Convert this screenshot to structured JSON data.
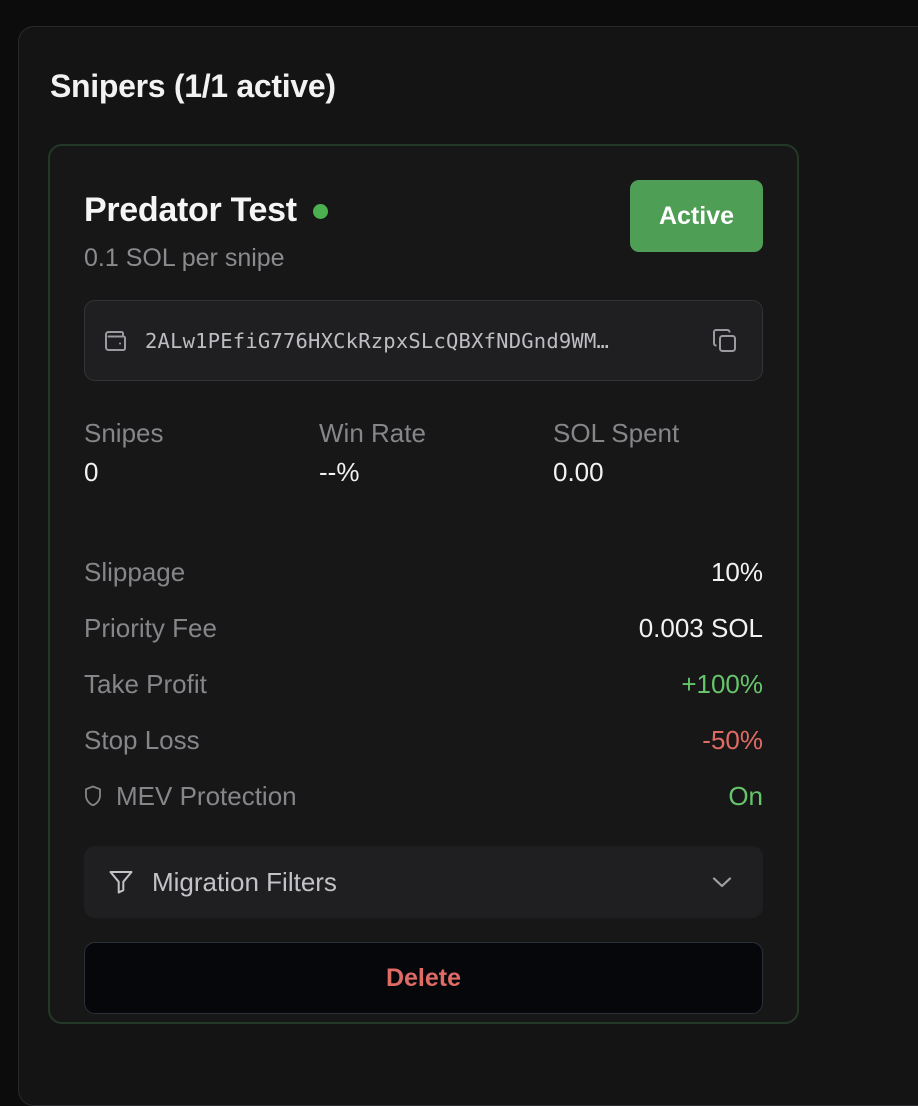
{
  "panel": {
    "title": "Snipers (1/1 active)"
  },
  "sniper": {
    "name": "Predator Test",
    "subtitle": "0.1 SOL per snipe",
    "status_button": "Active",
    "wallet_address": "2ALw1PEfiG776HXCkRzpxSLcQBXfNDGnd9WM…",
    "stats": [
      {
        "label": "Snipes",
        "value": "0"
      },
      {
        "label": "Win Rate",
        "value": "--%"
      },
      {
        "label": "SOL Spent",
        "value": "0.00"
      }
    ],
    "settings": [
      {
        "label": "Slippage",
        "value": "10%",
        "color": "#f2f2f3"
      },
      {
        "label": "Priority Fee",
        "value": "0.003 SOL",
        "color": "#f2f2f3"
      },
      {
        "label": "Take Profit",
        "value": "+100%",
        "color": "#66c46b"
      },
      {
        "label": "Stop Loss",
        "value": "-50%",
        "color": "#e06a64"
      },
      {
        "label": "MEV Protection",
        "value": "On",
        "color": "#66c46b",
        "icon": "shield-icon"
      }
    ],
    "filters_label": "Migration Filters",
    "delete_label": "Delete"
  },
  "colors": {
    "accent_green": "#4f9e56",
    "status_dot": "#4caf50",
    "positive": "#66c46b",
    "negative": "#e06a64"
  }
}
